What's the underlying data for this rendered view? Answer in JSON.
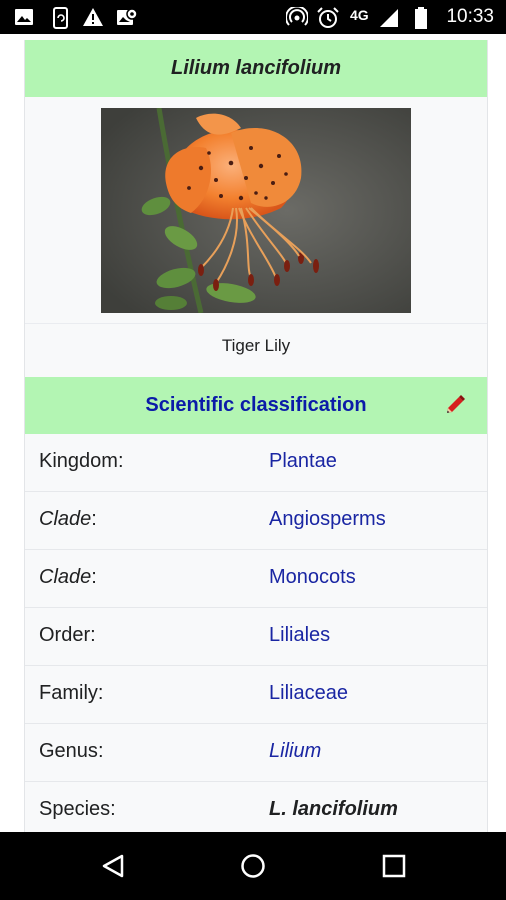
{
  "status_bar": {
    "time": "10:33",
    "network": "4G",
    "icons": [
      "image-icon",
      "phone-sync-icon",
      "warning-icon",
      "photo-settings-icon",
      "hotspot-icon",
      "alarm-icon",
      "signal-icon",
      "battery-icon"
    ]
  },
  "infobox": {
    "title": "Lilium lancifolium",
    "image_caption": "Tiger Lily",
    "classification_header": "Scientific classification",
    "rows": [
      {
        "key": "Kingdom",
        "key_italic": false,
        "value": "Plantae"
      },
      {
        "key": "Clade",
        "key_italic": true,
        "value": "Angiosperms"
      },
      {
        "key": "Clade",
        "key_italic": true,
        "value": "Monocots"
      },
      {
        "key": "Order",
        "key_italic": false,
        "value": "Liliales"
      },
      {
        "key": "Family",
        "key_italic": false,
        "value": "Liliaceae"
      },
      {
        "key": "Genus",
        "key_italic": false,
        "value": "Lilium"
      },
      {
        "key": "Species",
        "key_italic": false,
        "value": "L. lancifolium"
      }
    ]
  },
  "colors": {
    "header_green": "#b3f5b3",
    "link_blue": "#1a26a3",
    "edit_red": "#d61f1f"
  },
  "nav_bar": {
    "buttons": [
      "back-icon",
      "home-icon",
      "recents-icon"
    ]
  }
}
